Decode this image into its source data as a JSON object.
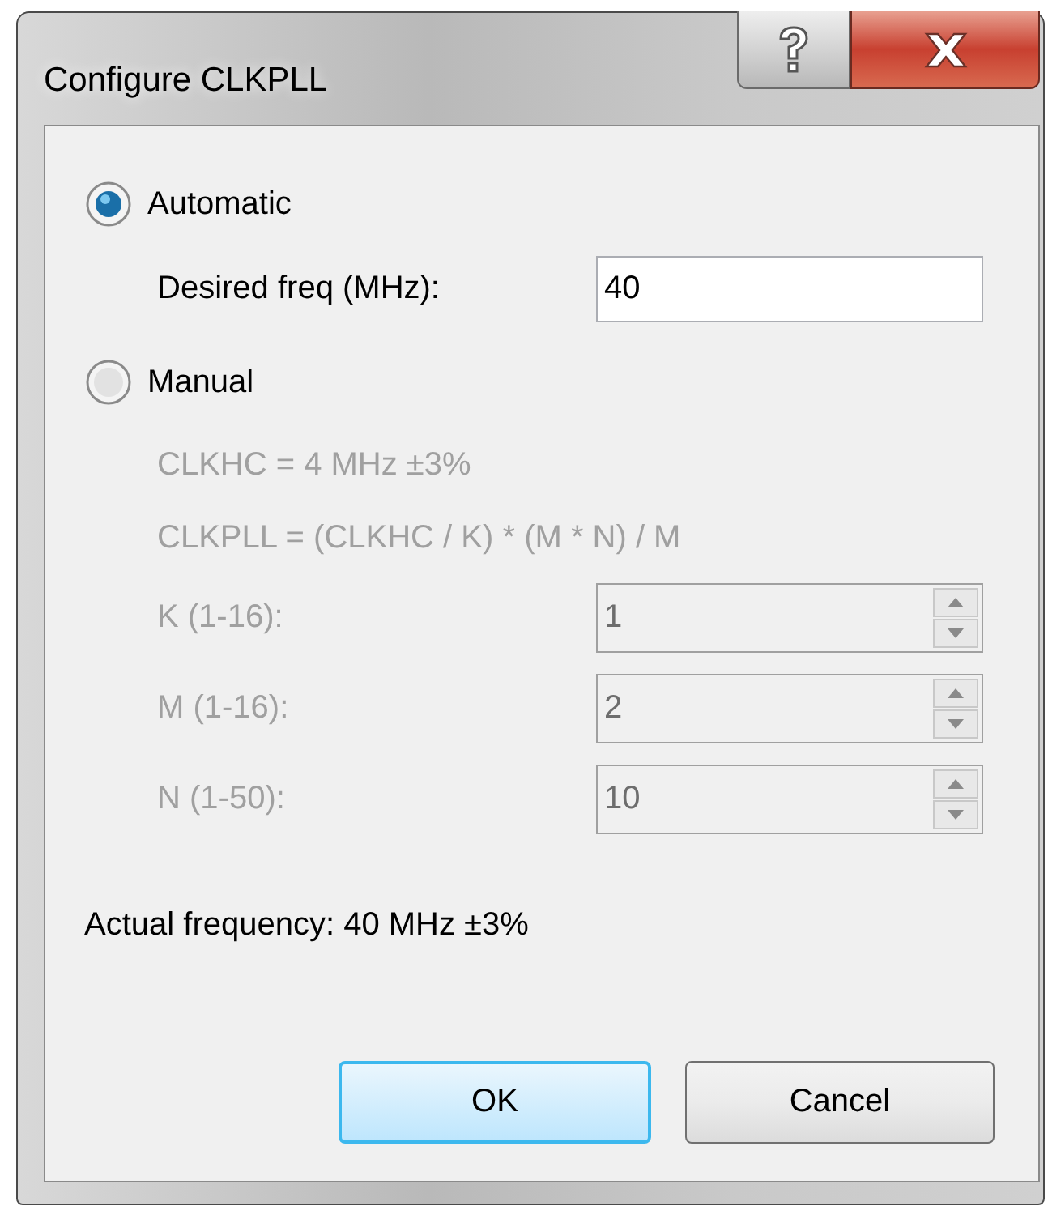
{
  "window": {
    "title": "Configure CLKPLL"
  },
  "modes": [
    {
      "label": "Automatic",
      "selected": true
    },
    {
      "label": "Manual",
      "selected": false
    }
  ],
  "automatic": {
    "label": "Desired freq (MHz):",
    "value": "40"
  },
  "manual": {
    "disabled": true,
    "info": [
      "CLKHC = 4 MHz ±3%",
      "CLKPLL = (CLKHC / K) * (M * N) / M"
    ],
    "params": [
      {
        "label": "K (1-16):",
        "value": "1"
      },
      {
        "label": "M (1-16):",
        "value": "2"
      },
      {
        "label": "N (1-50):",
        "value": "10"
      }
    ]
  },
  "actual_frequency": "Actual frequency: 40 MHz ±3%",
  "buttons": [
    {
      "label": "OK",
      "default": true
    },
    {
      "label": "Cancel",
      "default": false
    }
  ]
}
